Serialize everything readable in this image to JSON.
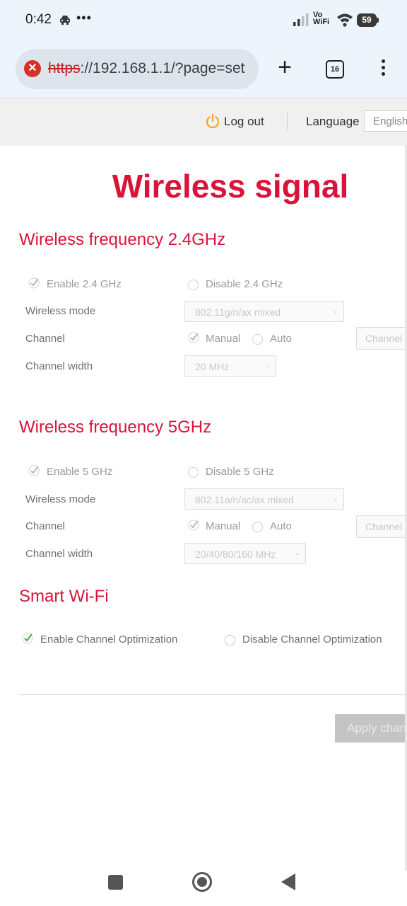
{
  "status_bar": {
    "time": "0:42",
    "dots": "•••",
    "vowifi_line1": "Vo",
    "vowifi_line2": "WiFi",
    "battery": "59"
  },
  "browser": {
    "url_scheme": "https",
    "url_rest": "://192.168.1.1/?page=set",
    "tab_count": "16",
    "new_tab_label": "+"
  },
  "header": {
    "logout_label": "Log out",
    "language_label": "Language",
    "language_value": "English"
  },
  "page_title": "Wireless signal",
  "band24": {
    "title": "Wireless frequency 2.4GHz",
    "enable_label": "Enable 2.4 GHz",
    "disable_label": "Disable 2.4 GHz",
    "mode_label": "Wireless mode",
    "mode_value": "802.11g/n/ax mixed",
    "channel_label": "Channel",
    "manual_label": "Manual",
    "auto_label": "Auto",
    "channel_placeholder": "Channel",
    "width_label": "Channel width",
    "width_value": "20 MHz"
  },
  "band5": {
    "title": "Wireless frequency 5GHz",
    "enable_label": "Enable 5 GHz",
    "disable_label": "Disable 5 GHz",
    "mode_label": "Wireless mode",
    "mode_value": "802.11a/n/ac/ax mixed",
    "channel_label": "Channel",
    "manual_label": "Manual",
    "auto_label": "Auto",
    "channel_placeholder": "Channel",
    "width_label": "Channel width",
    "width_value": "20/40/80/160 MHz"
  },
  "smart_wifi": {
    "title": "Smart Wi-Fi",
    "enable_label": "Enable Channel Optimization",
    "disable_label": "Disable Channel Optimization"
  },
  "apply_label": "Apply changes",
  "colors": {
    "accent": "#d9133a",
    "check_green": "#3cb043",
    "logout_icon": "#f5a623"
  }
}
